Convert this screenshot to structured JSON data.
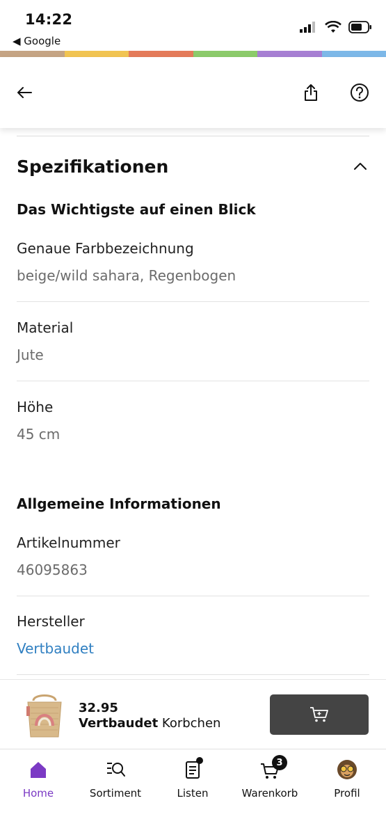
{
  "status_bar": {
    "time": "14:22",
    "back_app": "◀ Google"
  },
  "stripe_colors": [
    "#c5a484",
    "#f1c452",
    "#e47b5a",
    "#8ccb6b",
    "#a77fd3",
    "#7db8e8"
  ],
  "topbar": {
    "back_icon": "arrow-left-icon",
    "share_icon": "share-icon",
    "help_icon": "help-circle-icon"
  },
  "specs": {
    "title": "Spezifikationen",
    "group1_title": "Das Wichtigste auf einen Blick",
    "items": [
      {
        "label": "Genaue Farbbezeichnung",
        "value": "beige/wild sahara, Regenbogen"
      },
      {
        "label": "Material",
        "value": "Jute"
      },
      {
        "label": "Höhe",
        "value": "45 cm"
      }
    ],
    "group2_title": "Allgemeine Informationen",
    "items2": [
      {
        "label": "Artikelnummer",
        "value": "46095863"
      },
      {
        "label": "Hersteller",
        "value": "Vertbaudet"
      }
    ]
  },
  "cart_bar": {
    "price": "32.95",
    "brand": "Vertbaudet",
    "product": " Korbchen",
    "button_icon": "cart-icon"
  },
  "tabs": [
    {
      "label": "Home",
      "icon": "home-icon",
      "active": true
    },
    {
      "label": "Sortiment",
      "icon": "search-list-icon"
    },
    {
      "label": "Listen",
      "icon": "list-icon"
    },
    {
      "label": "Warenkorb",
      "icon": "cart-icon",
      "badge": "3"
    },
    {
      "label": "Profil",
      "icon": "avatar-icon"
    }
  ],
  "colors": {
    "accent": "#7b3ac4",
    "link": "#2f7fc1",
    "button": "#444444"
  }
}
